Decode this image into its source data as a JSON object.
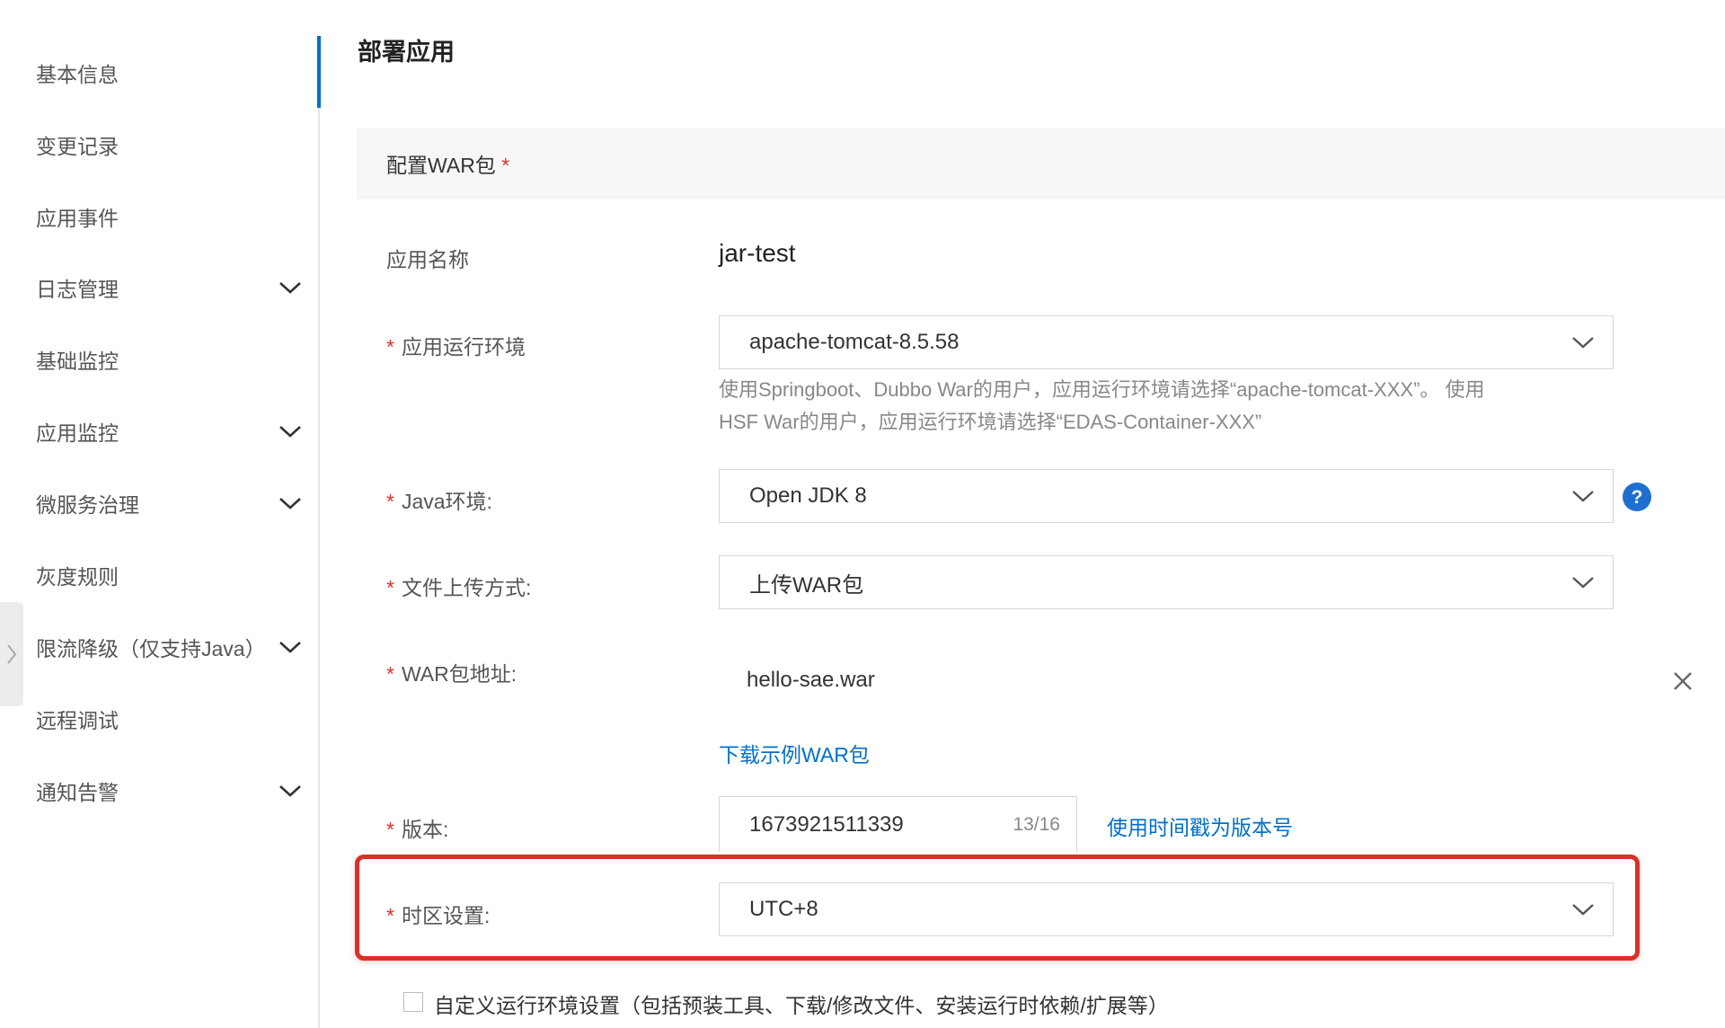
{
  "sidebar": {
    "items": [
      {
        "label": "基本信息",
        "active": true
      },
      {
        "label": "变更记录"
      },
      {
        "label": "应用事件"
      },
      {
        "label": "日志管理",
        "expandable": true
      },
      {
        "label": "基础监控"
      },
      {
        "label": "应用监控",
        "expandable": true
      },
      {
        "label": "微服务治理",
        "expandable": true
      },
      {
        "label": "灰度规则"
      },
      {
        "label": "限流降级（仅支持Java）",
        "expandable": true
      },
      {
        "label": "远程调试"
      },
      {
        "label": "通知告警",
        "expandable": true
      }
    ]
  },
  "page": {
    "title": "部署应用",
    "section_header": "配置WAR包",
    "required_mark": "*"
  },
  "form": {
    "app_name": {
      "label": "应用名称",
      "value": "jar-test"
    },
    "runtime": {
      "label": "应用运行环境",
      "value": "apache-tomcat-8.5.58",
      "help_line1": "使用Springboot、Dubbo War的用户，应用运行环境请选择“apache-tomcat-XXX”。 使用",
      "help_line2": "HSF War的用户，应用运行环境请选择“EDAS-Container-XXX”"
    },
    "java_env": {
      "label": "Java环境:",
      "value": "Open JDK 8"
    },
    "upload_method": {
      "label": "文件上传方式:",
      "value": "上传WAR包"
    },
    "war_address": {
      "label": "WAR包地址:",
      "file": "hello-sae.war",
      "download_link": "下载示例WAR包"
    },
    "version": {
      "label": "版本:",
      "value": "1673921511339",
      "counter": "13/16",
      "timestamp_link": "使用时间戳为版本号"
    },
    "timezone": {
      "label": "时区设置:",
      "value": "UTC+8"
    },
    "custom_runtime": {
      "label": "自定义运行环境设置（包括预装工具、下载/修改文件、安装运行时依赖/扩展等）",
      "checked": false
    }
  },
  "colors": {
    "accent": "#0070cc",
    "required": "#e0322c",
    "highlight_box": "#d9302a",
    "help_icon": "#1f6fd1"
  },
  "icons": {
    "chevron": "chevron-down-icon",
    "help": "help-circle-icon",
    "close": "close-icon",
    "collapse": "chevron-right-icon"
  }
}
